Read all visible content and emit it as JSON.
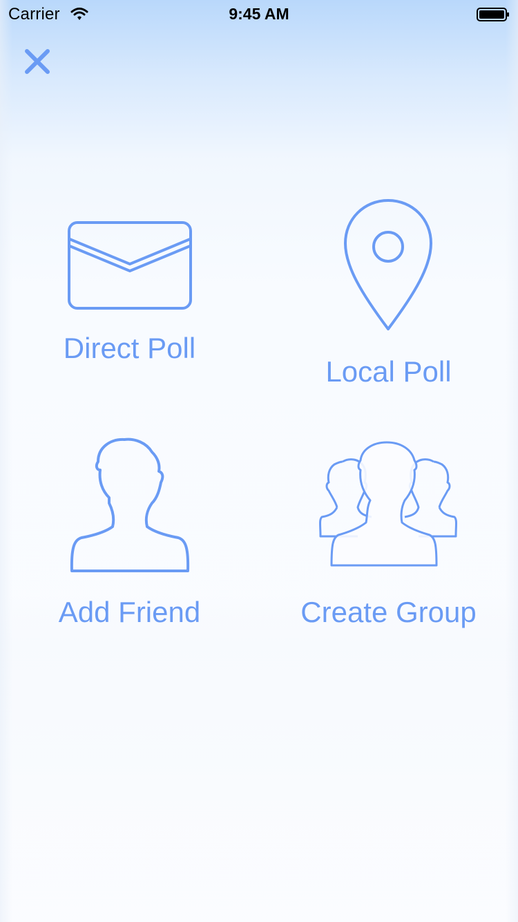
{
  "status_bar": {
    "carrier": "Carrier",
    "time": "9:45 AM",
    "wifi_icon": "wifi-icon",
    "battery_icon": "battery-icon"
  },
  "close_icon": "close-icon",
  "actions": [
    {
      "label": "Direct Poll",
      "icon": "envelope-icon"
    },
    {
      "label": "Local Poll",
      "icon": "location-pin-icon"
    },
    {
      "label": "Add Friend",
      "icon": "person-icon"
    },
    {
      "label": "Create Group",
      "icon": "group-icon"
    }
  ],
  "colors": {
    "accent": "#6a9bf4",
    "background_top": "#b9d8fb",
    "background_bottom": "#fbfcff"
  }
}
